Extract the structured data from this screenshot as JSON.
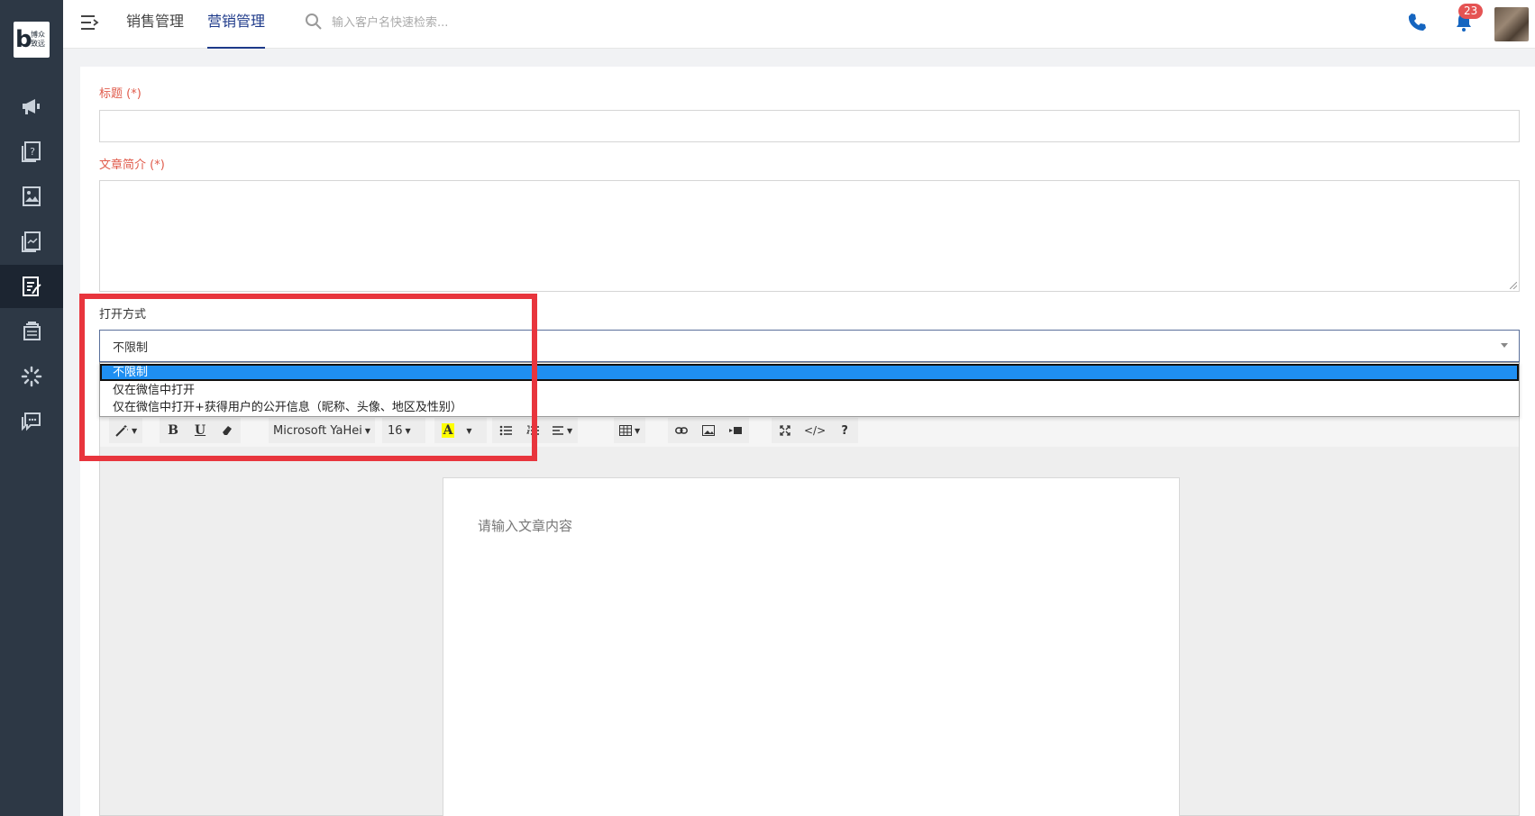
{
  "app": {
    "logo_letter": "b",
    "logo_text_1": "博众",
    "logo_text_2": "致远"
  },
  "sidebar": {
    "items": [
      {
        "icon": "megaphone-icon"
      },
      {
        "icon": "question-doc-icon"
      },
      {
        "icon": "image-doc-icon"
      },
      {
        "icon": "chart-doc-icon"
      },
      {
        "icon": "article-edit-icon",
        "active": true
      },
      {
        "icon": "stack-doc-icon"
      },
      {
        "icon": "spinner-icon"
      },
      {
        "icon": "chat-icon"
      }
    ]
  },
  "header": {
    "tabs": [
      {
        "label": "销售管理",
        "active": false
      },
      {
        "label": "营销管理",
        "active": true
      }
    ],
    "search_placeholder": "输入客户名快速检索...",
    "notification_count": "23"
  },
  "form": {
    "title_label": "标题 (*)",
    "title_value": "",
    "summary_label": "文章简介 (*)",
    "summary_value": "",
    "open_mode_label": "打开方式",
    "open_mode_value": "不限制",
    "open_mode_options": [
      "不限制",
      "仅在微信中打开",
      "仅在微信中打开+获得用户的公开信息（昵称、头像、地区及性别）"
    ]
  },
  "toolbar": {
    "font_name": "Microsoft YaHei",
    "font_size": "16",
    "bold": "B",
    "underline": "U",
    "color_letter": "A",
    "code": "</>",
    "help": "?"
  },
  "editor": {
    "placeholder": "请输入文章内容"
  },
  "colors": {
    "sidebar_bg": "#2d3845",
    "accent": "#1e3a8a",
    "required_label": "#e05b4b",
    "selected_option": "#1f8ff2",
    "highlight": "#e8353d"
  }
}
